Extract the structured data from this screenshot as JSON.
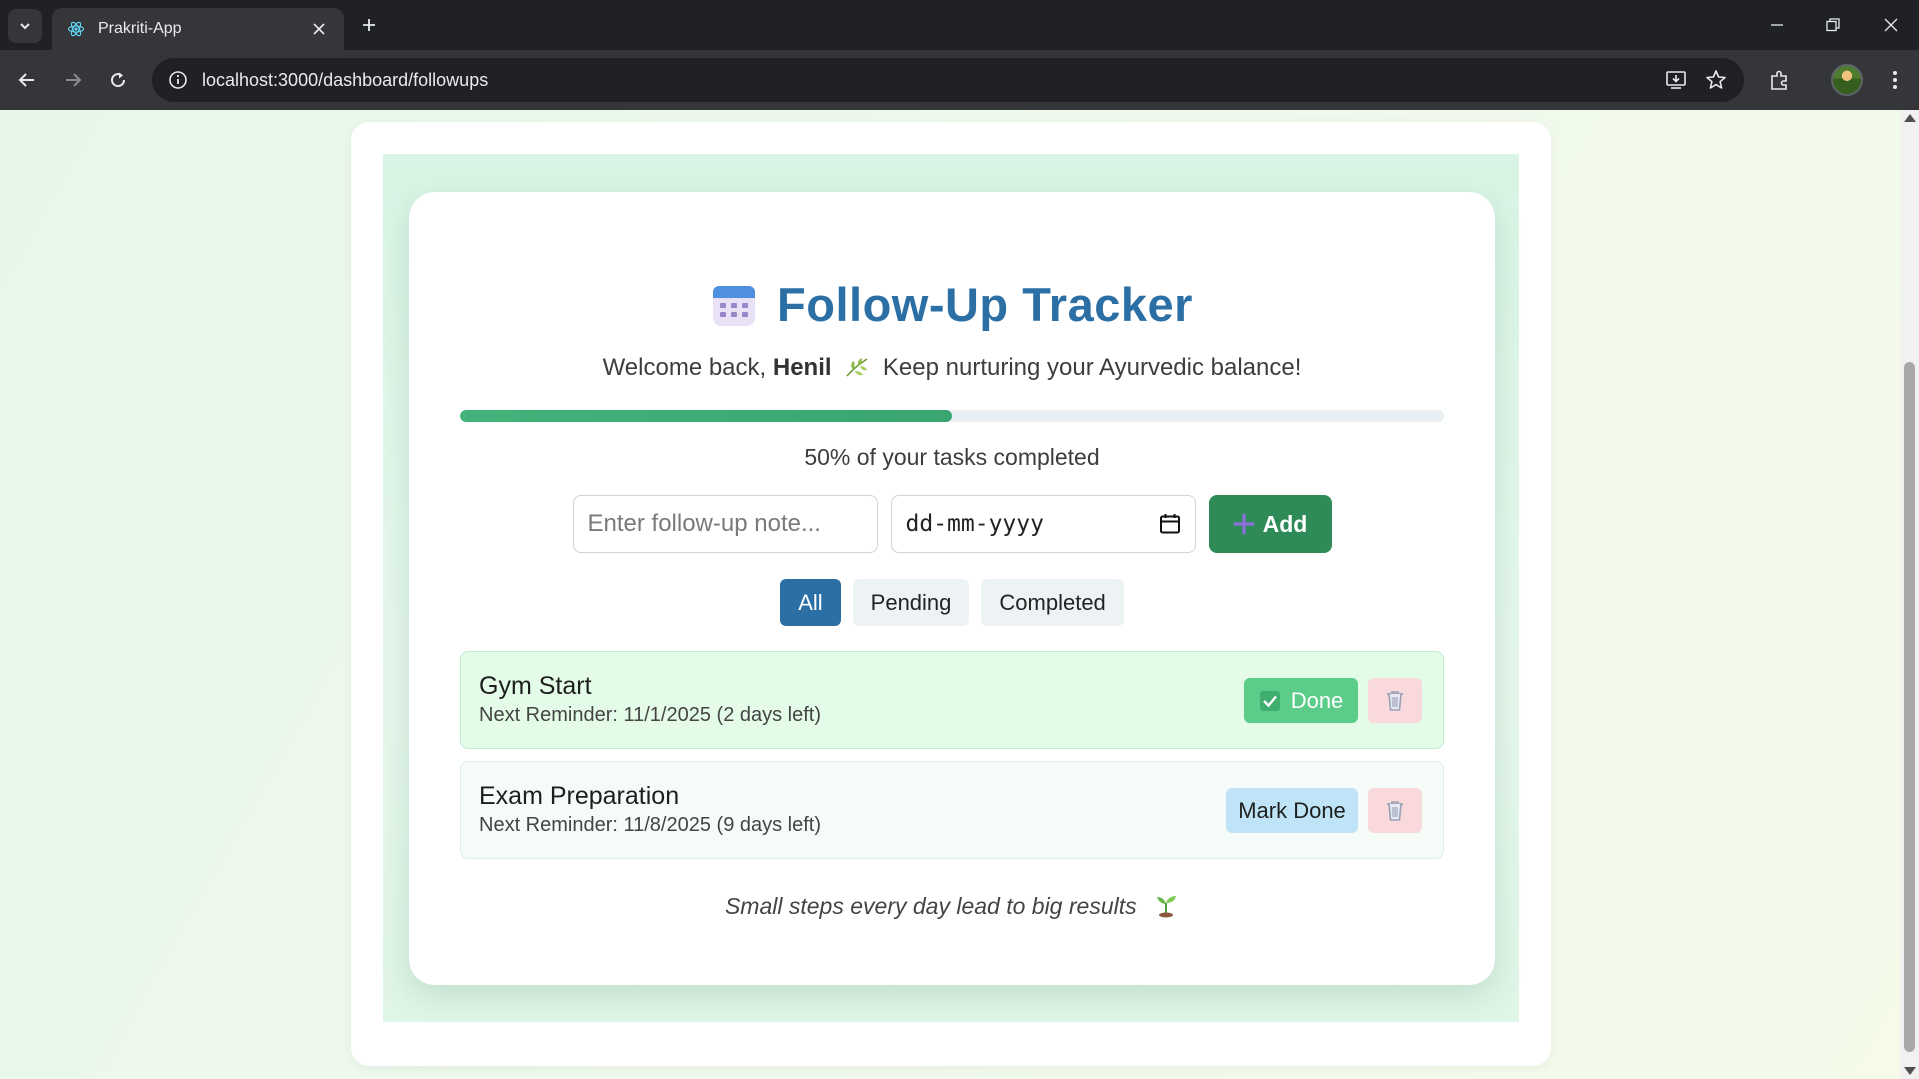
{
  "browser": {
    "tab_title": "Prakriti-App",
    "url": "localhost:3000/dashboard/followups"
  },
  "page": {
    "title": "Follow-Up Tracker",
    "welcome_prefix": "Welcome back,",
    "user_name": "Henil",
    "welcome_suffix": "Keep nurturing your Ayurvedic balance!",
    "progress_percent": 50,
    "progress_text": "50% of your tasks completed",
    "note_placeholder": "Enter follow-up note...",
    "date_placeholder": "dd-mm-yyyy",
    "add_label": "Add",
    "filters": [
      "All",
      "Pending",
      "Completed"
    ],
    "active_filter": "All",
    "tasks": [
      {
        "title": "Gym Start",
        "reminder": "Next Reminder: 11/1/2025 (2 days left)",
        "status": "done",
        "action_label": "Done"
      },
      {
        "title": "Exam Preparation",
        "reminder": "Next Reminder: 11/8/2025 (9 days left)",
        "status": "pending",
        "action_label": "Mark Done"
      }
    ],
    "quote": "Small steps every day lead to big results"
  },
  "colors": {
    "title": "#2c6fa5",
    "progress": "#43b37a",
    "add_button": "#2e8b57",
    "active_filter": "#2c6fa5",
    "done_button": "#5ccc8a",
    "mark_done_button": "#bfe4f7",
    "delete_button": "#f9d9dc"
  },
  "icons": {
    "tab_favicon": "react-icon",
    "title_icon": "calendar-icon",
    "welcome_icon": "herb-icon",
    "add_icon": "plus-icon",
    "done_icon": "check-icon",
    "delete_icon": "trash-icon",
    "quote_icon": "seedling-icon"
  }
}
